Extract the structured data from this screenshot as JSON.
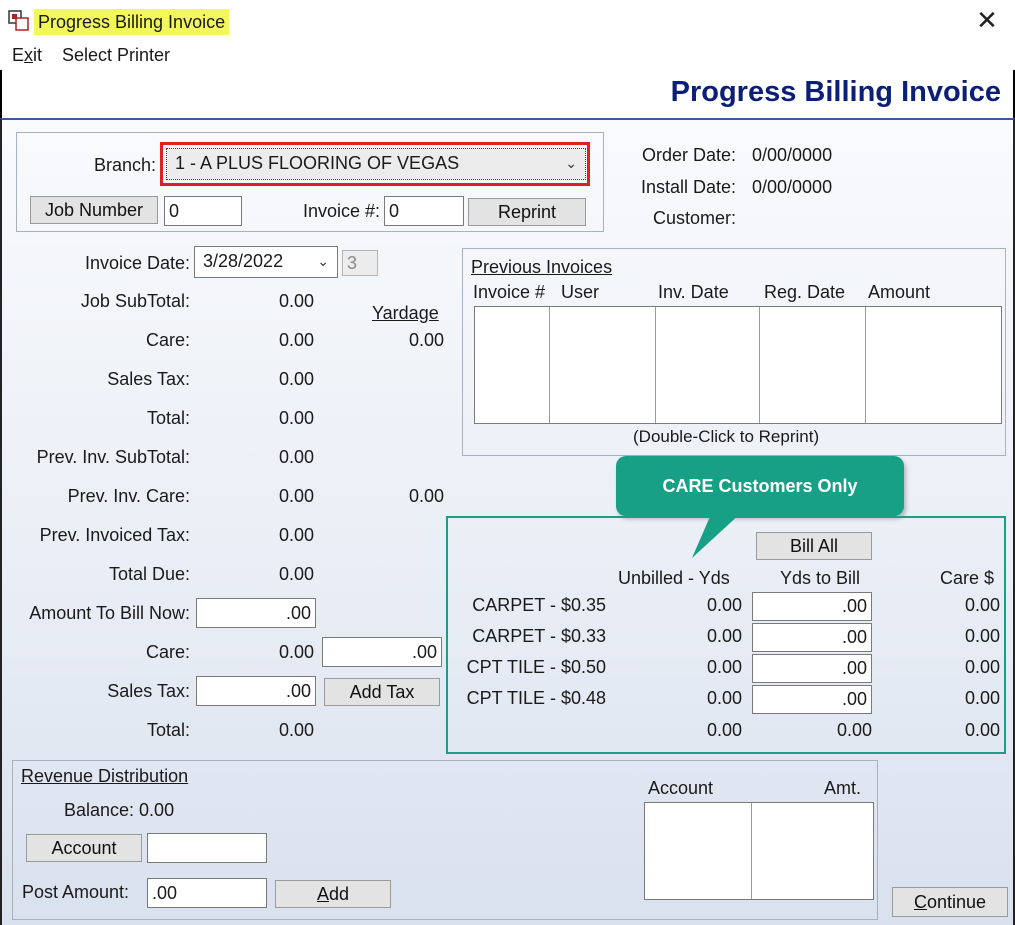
{
  "window": {
    "title": "Progress Billing Invoice",
    "close_glyph": "✕"
  },
  "menu": {
    "exit": "Exit",
    "exit_mnemonic": "x",
    "select_printer": "Select Printer"
  },
  "banner": {
    "title": "Progress Billing Invoice"
  },
  "header": {
    "branch_label": "Branch:",
    "branch_value": "1  - A PLUS FLOORING OF VEGAS",
    "job_number_button": "Job Number",
    "job_number_value": "0",
    "invoice_no_label": "Invoice #:",
    "invoice_no_value": "0",
    "reprint_button": "Reprint",
    "order_date_label": "Order Date:",
    "order_date_value": "0/00/0000",
    "install_date_label": "Install Date:",
    "install_date_value": "0/00/0000",
    "customer_label": "Customer:"
  },
  "totals": {
    "invoice_date_label": "Invoice Date:",
    "invoice_date_value": "3/28/2022",
    "invoice_date_extra": "3",
    "yardage_label": "Yardage",
    "rows": [
      {
        "label": "Job SubTotal:",
        "value": "0.00",
        "yardage": ""
      },
      {
        "label": "Care:",
        "value": "0.00",
        "yardage": "0.00"
      },
      {
        "label": "Sales Tax:",
        "value": "0.00",
        "yardage": ""
      },
      {
        "label": "Total:",
        "value": "0.00",
        "yardage": ""
      },
      {
        "label": "Prev. Inv. SubTotal:",
        "value": "0.00",
        "yardage": ""
      },
      {
        "label": "Prev. Inv. Care:",
        "value": "0.00",
        "yardage": "0.00"
      },
      {
        "label": "Prev. Invoiced Tax:",
        "value": "0.00",
        "yardage": ""
      },
      {
        "label": "Total Due:",
        "value": "0.00",
        "yardage": ""
      }
    ],
    "amount_to_bill_label": "Amount To Bill Now:",
    "amount_to_bill_value": ".00",
    "care_label": "Care:",
    "care_value": "0.00",
    "care_input": ".00",
    "sales_tax_label": "Sales Tax:",
    "sales_tax_input": ".00",
    "add_tax_button": "Add Tax",
    "total_label": "Total:",
    "total_value": "0.00"
  },
  "previous_invoices": {
    "title": "Previous Invoices",
    "columns": [
      "Invoice #",
      "User",
      "Inv. Date",
      "Reg. Date",
      "Amount"
    ],
    "hint": "(Double-Click to Reprint)"
  },
  "care": {
    "callout": "CARE Customers Only",
    "bill_all_button": "Bill All",
    "col_unbilled": "Unbilled - Yds",
    "col_to_bill": "Yds to Bill",
    "col_care": "Care $",
    "rows": [
      {
        "label": "CARPET - $0.35",
        "unbilled": "0.00",
        "to_bill": ".00",
        "care": "0.00"
      },
      {
        "label": "CARPET - $0.33",
        "unbilled": "0.00",
        "to_bill": ".00",
        "care": "0.00"
      },
      {
        "label": "CPT TILE - $0.50",
        "unbilled": "0.00",
        "to_bill": ".00",
        "care": "0.00"
      },
      {
        "label": "CPT TILE - $0.48",
        "unbilled": "0.00",
        "to_bill": ".00",
        "care": "0.00"
      }
    ],
    "total_unbilled": "0.00",
    "total_to_bill": "0.00",
    "total_care": "0.00",
    "accent": "#17a085"
  },
  "revenue": {
    "title": "Revenue Distribution",
    "balance_label": "Balance: 0.00",
    "account_button": "Account",
    "account_value": "",
    "post_amount_label": "Post Amount:",
    "post_amount_value": ".00",
    "add_button": "Add",
    "col_account": "Account",
    "col_amount": "Amt."
  },
  "footer": {
    "continue_button": "Continue"
  },
  "colors": {
    "banner_title": "#0b1e78",
    "title_highlight": "#f2f75a",
    "branch_border": "#e02020"
  }
}
